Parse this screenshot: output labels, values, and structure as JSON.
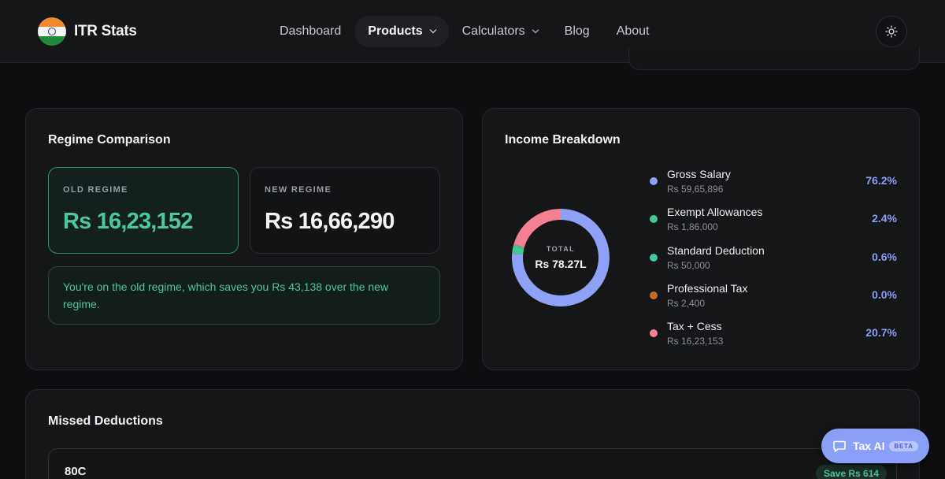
{
  "brand": {
    "name": "ITR Stats",
    "logo_icon": "india-flag-icon"
  },
  "nav": {
    "items": [
      {
        "label": "Dashboard",
        "dropdown": false,
        "active": false
      },
      {
        "label": "Products",
        "dropdown": true,
        "active": true
      },
      {
        "label": "Calculators",
        "dropdown": true,
        "active": false
      },
      {
        "label": "Blog",
        "dropdown": false,
        "active": false
      },
      {
        "label": "About",
        "dropdown": false,
        "active": false
      }
    ],
    "theme_icon": "sun-icon"
  },
  "regime": {
    "title": "Regime Comparison",
    "old": {
      "label": "OLD REGIME",
      "value": "Rs 16,23,152"
    },
    "new": {
      "label": "NEW REGIME",
      "value": "Rs 16,66,290"
    },
    "note": "You're on the old regime, which saves you Rs 43,138 over the new regime."
  },
  "income": {
    "title": "Income Breakdown",
    "total_caption": "TOTAL",
    "total_value": "Rs 78.27L",
    "items": [
      {
        "name": "Gross Salary",
        "amount": "Rs 59,65,896",
        "pct": "76.2%",
        "share": 76.2,
        "color": "#8fa1f7"
      },
      {
        "name": "Exempt Allowances",
        "amount": "Rs 1,86,000",
        "pct": "2.4%",
        "share": 2.4,
        "color": "#45c990"
      },
      {
        "name": "Standard Deduction",
        "amount": "Rs 50,000",
        "pct": "0.6%",
        "share": 0.6,
        "color": "#3fcaa0"
      },
      {
        "name": "Professional Tax",
        "amount": "Rs 2,400",
        "pct": "0.0%",
        "share": 0.03,
        "color": "#c66d1f"
      },
      {
        "name": "Tax + Cess",
        "amount": "Rs 16,23,153",
        "pct": "20.7%",
        "share": 20.7,
        "color": "#f57f93"
      }
    ]
  },
  "missed": {
    "title": "Missed Deductions",
    "items": [
      {
        "name": "80C",
        "save": "Save Rs 614"
      }
    ]
  },
  "tax_ai": {
    "label": "Tax AI",
    "badge": "BETA",
    "icon": "chat-bubble-icon"
  },
  "colors": {
    "accent_green": "#4cc89a",
    "accent_blue": "#8d9cf5"
  }
}
